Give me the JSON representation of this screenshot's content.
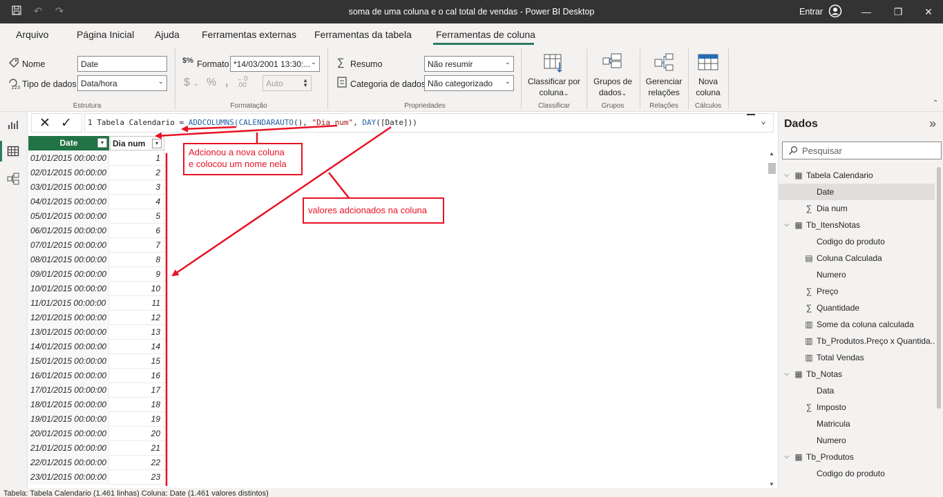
{
  "window": {
    "title": "soma de uma coluna e o cal total de vendas - Power BI Desktop",
    "signin": "Entrar"
  },
  "tabs": [
    {
      "label": "Arquivo"
    },
    {
      "label": "Página Inicial"
    },
    {
      "label": "Ajuda"
    },
    {
      "label": "Ferramentas externas"
    },
    {
      "label": "Ferramentas da tabela"
    },
    {
      "label": "Ferramentas de coluna",
      "active": true
    }
  ],
  "ribbon": {
    "estrutura": {
      "name_label": "Nome",
      "name_value": "Date",
      "type_label": "Tipo de dados",
      "type_value": "Data/hora",
      "caption": "Estrutura"
    },
    "formatacao": {
      "format_label": "Formato",
      "format_value": "*14/03/2001 13:30:...",
      "auto_value": "Auto",
      "caption": "Formatação"
    },
    "propriedades": {
      "summary_label": "Resumo",
      "summary_value": "Não resumir",
      "category_label": "Categoria de dados",
      "category_value": "Não categorizado",
      "caption": "Propriedades"
    },
    "classificar": {
      "button_line1": "Classificar por",
      "button_line2": "coluna",
      "caption": "Classificar"
    },
    "grupos": {
      "button_line1": "Grupos de",
      "button_line2": "dados",
      "caption": "Grupos"
    },
    "relacoes": {
      "button_line1": "Gerenciar",
      "button_line2": "relações",
      "caption": "Relações"
    },
    "calculos": {
      "button_line1": "Nova",
      "button_line2": "coluna",
      "caption": "Cálculos"
    }
  },
  "formula": {
    "line_no": "1",
    "prefix": "Tabela Calendario = ",
    "fn1": "ADDCOLUMNS(",
    "fn2": "CALENDARAUTO",
    "mid": "(), ",
    "str": "\"Dia num\"",
    "comma": ", ",
    "fn3": "DAY",
    "tail": "([Date]))"
  },
  "table": {
    "columns": [
      "Date",
      "Dia num"
    ],
    "rows": [
      [
        "01/01/2015 00:00:00",
        "1"
      ],
      [
        "02/01/2015 00:00:00",
        "2"
      ],
      [
        "03/01/2015 00:00:00",
        "3"
      ],
      [
        "04/01/2015 00:00:00",
        "4"
      ],
      [
        "05/01/2015 00:00:00",
        "5"
      ],
      [
        "06/01/2015 00:00:00",
        "6"
      ],
      [
        "07/01/2015 00:00:00",
        "7"
      ],
      [
        "08/01/2015 00:00:00",
        "8"
      ],
      [
        "09/01/2015 00:00:00",
        "9"
      ],
      [
        "10/01/2015 00:00:00",
        "10"
      ],
      [
        "11/01/2015 00:00:00",
        "11"
      ],
      [
        "12/01/2015 00:00:00",
        "12"
      ],
      [
        "13/01/2015 00:00:00",
        "13"
      ],
      [
        "14/01/2015 00:00:00",
        "14"
      ],
      [
        "15/01/2015 00:00:00",
        "15"
      ],
      [
        "16/01/2015 00:00:00",
        "16"
      ],
      [
        "17/01/2015 00:00:00",
        "17"
      ],
      [
        "18/01/2015 00:00:00",
        "18"
      ],
      [
        "19/01/2015 00:00:00",
        "19"
      ],
      [
        "20/01/2015 00:00:00",
        "20"
      ],
      [
        "21/01/2015 00:00:00",
        "21"
      ],
      [
        "22/01/2015 00:00:00",
        "22"
      ],
      [
        "23/01/2015 00:00:00",
        "23"
      ]
    ]
  },
  "annotations": {
    "note1_line1": "Adcionou a nova coluna",
    "note1_line2": "e colocou um nome nela",
    "note2": "valores adcionados na coluna"
  },
  "data_pane": {
    "title": "Dados",
    "search_placeholder": "Pesquisar",
    "items": [
      {
        "level": 0,
        "icon": "calendar-table-icon",
        "label": "Tabela Calendario"
      },
      {
        "level": 1,
        "icon": "",
        "label": "Date",
        "selected": true
      },
      {
        "level": 1,
        "icon": "sigma-icon",
        "label": "Dia num"
      },
      {
        "level": 0,
        "icon": "table-icon",
        "label": "Tb_ItensNotas"
      },
      {
        "level": 1,
        "icon": "",
        "label": "Codigo do produto"
      },
      {
        "level": 1,
        "icon": "calculated-column-icon",
        "label": "Coluna Calculada"
      },
      {
        "level": 1,
        "icon": "",
        "label": "Numero"
      },
      {
        "level": 1,
        "icon": "sigma-icon",
        "label": "Preço"
      },
      {
        "level": 1,
        "icon": "sigma-icon",
        "label": "Quantidade"
      },
      {
        "level": 1,
        "icon": "calculator-icon",
        "label": "Some da coluna calculada"
      },
      {
        "level": 1,
        "icon": "calculator-icon",
        "label": "Tb_Produtos.Preço x Quantida..."
      },
      {
        "level": 1,
        "icon": "calculator-icon",
        "label": "Total Vendas"
      },
      {
        "level": 0,
        "icon": "table-icon",
        "label": "Tb_Notas"
      },
      {
        "level": 1,
        "icon": "",
        "label": "Data"
      },
      {
        "level": 1,
        "icon": "sigma-icon",
        "label": "Imposto"
      },
      {
        "level": 1,
        "icon": "",
        "label": "Matricula"
      },
      {
        "level": 1,
        "icon": "",
        "label": "Numero"
      },
      {
        "level": 0,
        "icon": "table-icon",
        "label": "Tb_Produtos"
      },
      {
        "level": 1,
        "icon": "",
        "label": "Codigo do produto"
      }
    ]
  },
  "status": "Tabela: Tabela Calendario (1.461 linhas) Coluna: Date (1.461 valores distintos)",
  "colors": {
    "accent": "#217346",
    "annotation": "#e81123"
  }
}
